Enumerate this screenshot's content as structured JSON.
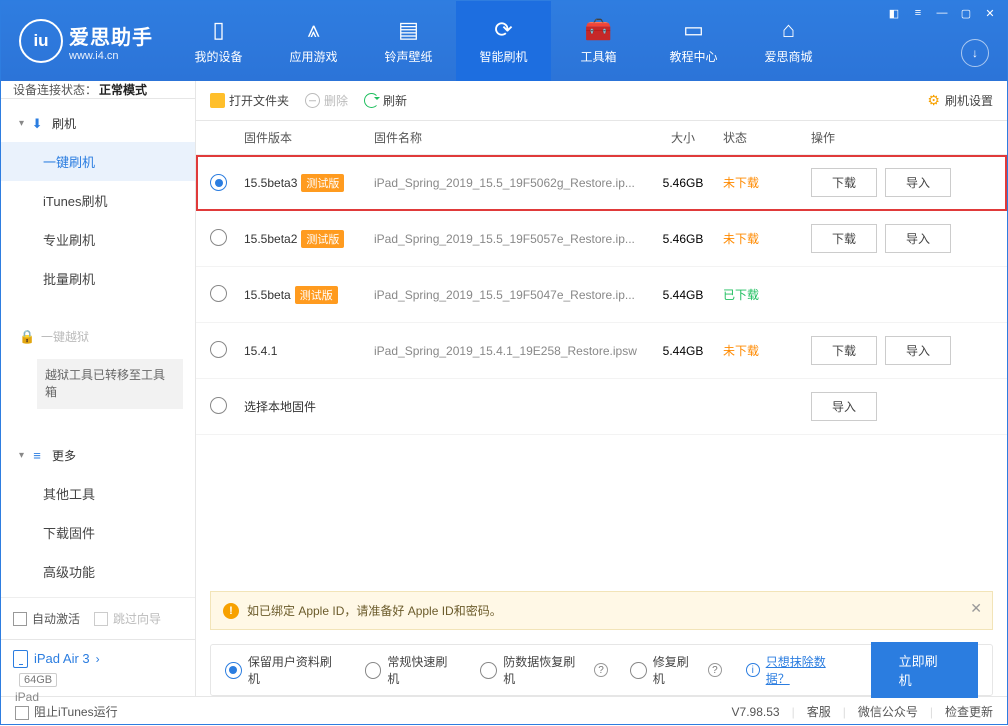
{
  "app": {
    "title": "爱思助手",
    "subtitle": "www.i4.cn"
  },
  "nav": {
    "items": [
      {
        "label": "我的设备"
      },
      {
        "label": "应用游戏"
      },
      {
        "label": "铃声壁纸"
      },
      {
        "label": "智能刷机"
      },
      {
        "label": "工具箱"
      },
      {
        "label": "教程中心"
      },
      {
        "label": "爱思商城"
      }
    ],
    "active_index": 3
  },
  "connection": {
    "label": "设备连接状态：",
    "value": "正常模式"
  },
  "sidebar": {
    "flash": {
      "title": "刷机",
      "items": [
        "一键刷机",
        "iTunes刷机",
        "专业刷机",
        "批量刷机"
      ],
      "active": 0
    },
    "jailbreak": {
      "title": "一键越狱",
      "note": "越狱工具已转移至工具箱"
    },
    "more": {
      "title": "更多",
      "items": [
        "其他工具",
        "下载固件",
        "高级功能"
      ]
    },
    "auto_activate": "自动激活",
    "skip_guide": "跳过向导"
  },
  "toolbar": {
    "open": "打开文件夹",
    "delete": "删除",
    "refresh": "刷新",
    "settings": "刷机设置"
  },
  "columns": {
    "version": "固件版本",
    "name": "固件名称",
    "size": "大小",
    "status": "状态",
    "ops": "操作"
  },
  "firmware": [
    {
      "selected": true,
      "version": "15.5beta3",
      "beta": "测试版",
      "name": "iPad_Spring_2019_15.5_19F5062g_Restore.ip...",
      "size": "5.46GB",
      "status": "未下载",
      "status_class": "down",
      "ops": [
        "下载",
        "导入"
      ]
    },
    {
      "selected": false,
      "version": "15.5beta2",
      "beta": "测试版",
      "name": "iPad_Spring_2019_15.5_19F5057e_Restore.ip...",
      "size": "5.46GB",
      "status": "未下载",
      "status_class": "down",
      "ops": [
        "下载",
        "导入"
      ]
    },
    {
      "selected": false,
      "version": "15.5beta",
      "beta": "测试版",
      "name": "iPad_Spring_2019_15.5_19F5047e_Restore.ip...",
      "size": "5.44GB",
      "status": "已下载",
      "status_class": "ok",
      "ops": []
    },
    {
      "selected": false,
      "version": "15.4.1",
      "beta": "",
      "name": "iPad_Spring_2019_15.4.1_19E258_Restore.ipsw",
      "size": "5.44GB",
      "status": "未下载",
      "status_class": "down",
      "ops": [
        "下载",
        "导入"
      ]
    },
    {
      "selected": false,
      "version": "选择本地固件",
      "beta": "",
      "name": "",
      "size": "",
      "status": "",
      "status_class": "",
      "ops": [
        "导入"
      ]
    }
  ],
  "notice": "如已绑定 Apple ID，请准备好 Apple ID和密码。",
  "flash_options": {
    "opts": [
      "保留用户资料刷机",
      "常规快速刷机",
      "防数据恢复刷机",
      "修复刷机"
    ],
    "selected": 0,
    "erase_link": "只想抹除数据？",
    "button": "立即刷机"
  },
  "device": {
    "name": "iPad Air 3",
    "capacity": "64GB",
    "type": "iPad"
  },
  "footer": {
    "block_itunes": "阻止iTunes运行",
    "version": "V7.98.53",
    "links": [
      "客服",
      "微信公众号",
      "检查更新"
    ]
  }
}
